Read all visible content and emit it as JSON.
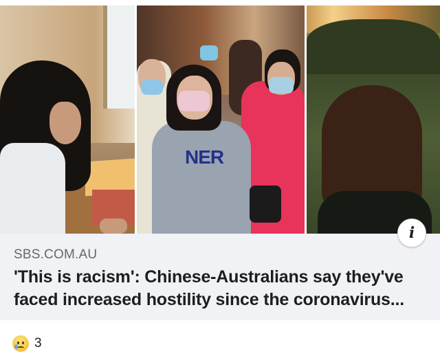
{
  "link_preview": {
    "domain": "SBS.COM.AU",
    "title": "'This is racism': Chinese-Australians say they've faced increased hostility since the coronavirus..."
  },
  "photos": {
    "sweater_text": "NER"
  },
  "info_button": {
    "icon": "info-icon",
    "glyph": "i"
  },
  "reactions": {
    "type": "sad",
    "count": "3"
  },
  "colors": {
    "preview_background": "#f0f2f5",
    "domain_text": "#65676b",
    "title_text": "#1c1e21"
  }
}
